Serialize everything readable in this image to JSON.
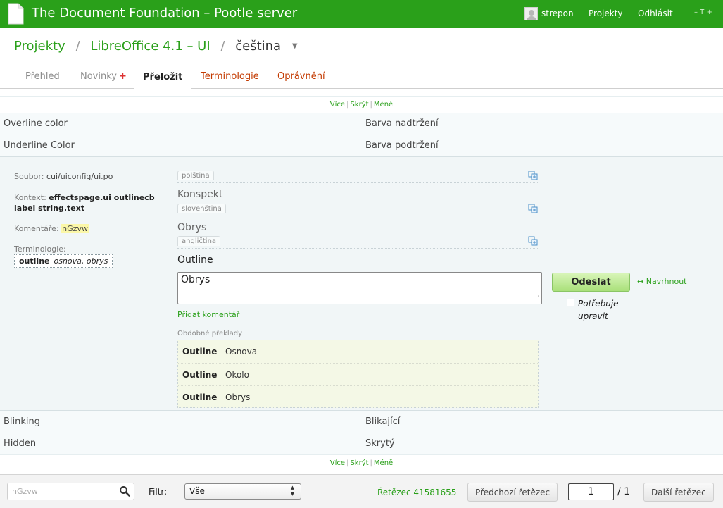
{
  "header": {
    "site_title": "The Document Foundation – Pootle server",
    "username": "strepon",
    "projects_link": "Projekty",
    "logout_link": "Odhlásit",
    "font_controls": "–  T  +"
  },
  "breadcrumb": {
    "projects": "Projekty",
    "project": "LibreOffice 4.1 – UI",
    "language": "čeština",
    "separator": "/",
    "caret": "▼"
  },
  "tabs": [
    {
      "label": "Přehled"
    },
    {
      "label": "Novinky",
      "badge": "+"
    },
    {
      "label": "Přeložit"
    },
    {
      "label": "Terminologie"
    },
    {
      "label": "Oprávnění"
    }
  ],
  "more_controls": {
    "more": "Více",
    "hide": "Skrýt",
    "less": "Méně",
    "sep": "|"
  },
  "context_before": [
    {
      "source": "Overline color",
      "target": "Barva nadtržení"
    },
    {
      "source": "Underline Color",
      "target": "Barva podtržení"
    }
  ],
  "context_after": [
    {
      "source": "Blinking",
      "target": "Blikající"
    },
    {
      "source": "Hidden",
      "target": "Skrytý"
    }
  ],
  "unit": {
    "file_label": "Soubor:",
    "file_path": "cui/uiconfig/ui.po",
    "context_label": "Kontext:",
    "context_line1": "effectspage.ui outlinecb",
    "context_line2": "label string.text",
    "comments_label": "Komentáře:",
    "comment": "nGzvw",
    "terminology_label": "Terminologie:",
    "term_source": "outline",
    "term_target": "osnova, obrys"
  },
  "alt_languages": [
    {
      "lang": "polština",
      "text": "Konspekt"
    },
    {
      "lang": "slovenština",
      "text": "Obrys"
    },
    {
      "lang": "angličtina"
    }
  ],
  "source_text": "Outline",
  "translation_value": "Obrys",
  "actions": {
    "submit": "Odeslat",
    "suggest": "↔ Navrhnout",
    "fuzzy_label": "Potřebuje upravit",
    "add_comment": "Přidat komentář"
  },
  "similar": {
    "title": "Obdobné překlady",
    "rows": [
      {
        "source": "Outline",
        "target": "Osnova"
      },
      {
        "source": "Outline",
        "target": "Okolo"
      },
      {
        "source": "Outline",
        "target": "Obrys"
      }
    ]
  },
  "footer": {
    "search_placeholder": "nGzvw",
    "filter_label": "Filtr:",
    "filter_value": "Vše",
    "unit_id": "Řetězec 41581655",
    "prev_button": "Předchozí řetězec",
    "page_value": "1",
    "page_total": "/ 1",
    "next_button": "Další řetězec"
  },
  "colors": {
    "brand_green": "#2aa01a",
    "tab_red": "#c33a00",
    "editor_bg": "#f1f6f7",
    "comment_highlight": "#fbf7a8"
  }
}
